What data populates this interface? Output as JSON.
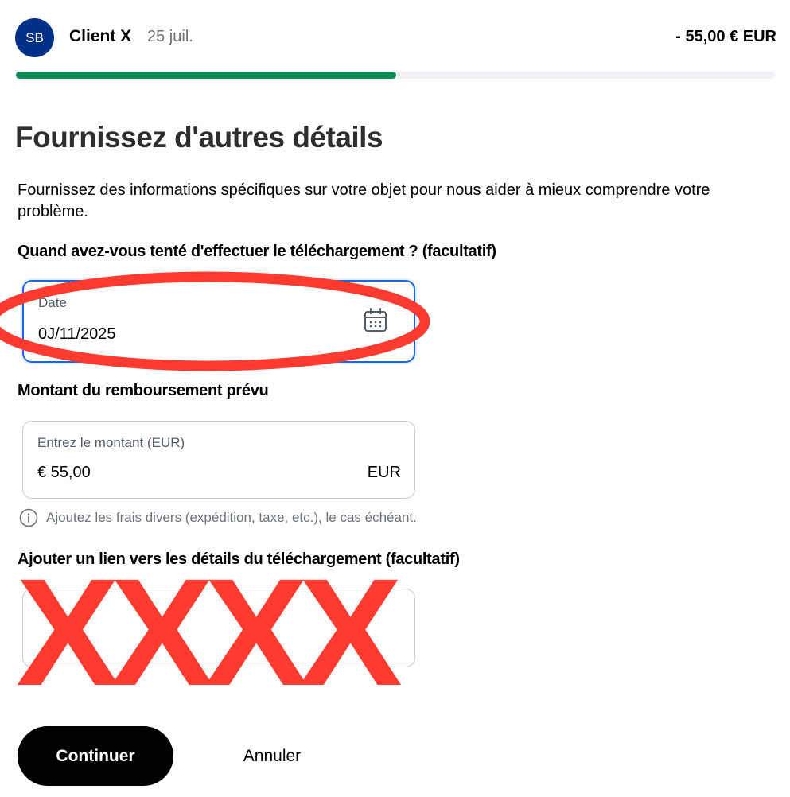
{
  "header": {
    "avatar_initials": "SB",
    "client_name": "Client X",
    "date": "25 juil.",
    "amount": "- 55,00 € EUR",
    "progress": 0.5
  },
  "page": {
    "title": "Fournissez d'autres détails",
    "description": "Fournissez des informations spécifiques sur votre objet pour nous aider à mieux comprendre votre problème."
  },
  "fields": {
    "date_question": "Quand avez-vous tenté d'effectuer le téléchargement ? (facultatif)",
    "date_label": "Date",
    "date_value": "0J/11/2025",
    "amount_question": "Montant du remboursement prévu",
    "amount_label": "Entrez le montant (EUR)",
    "amount_value": "€ 55,00",
    "amount_currency": "EUR",
    "helper_text": "Ajoutez les frais divers (expédition, taxe, etc.), le cas échéant.",
    "link_question": "Ajouter un lien vers les détails du téléchargement (facultatif)",
    "link_value": ""
  },
  "annotations": {
    "redaction_text": "XXXX",
    "color": "#ff3b30"
  },
  "actions": {
    "continue_label": "Continuer",
    "cancel_label": "Annuler"
  },
  "colors": {
    "progress": "#108a56",
    "focus": "#1a67e0",
    "avatar": "#003087"
  }
}
